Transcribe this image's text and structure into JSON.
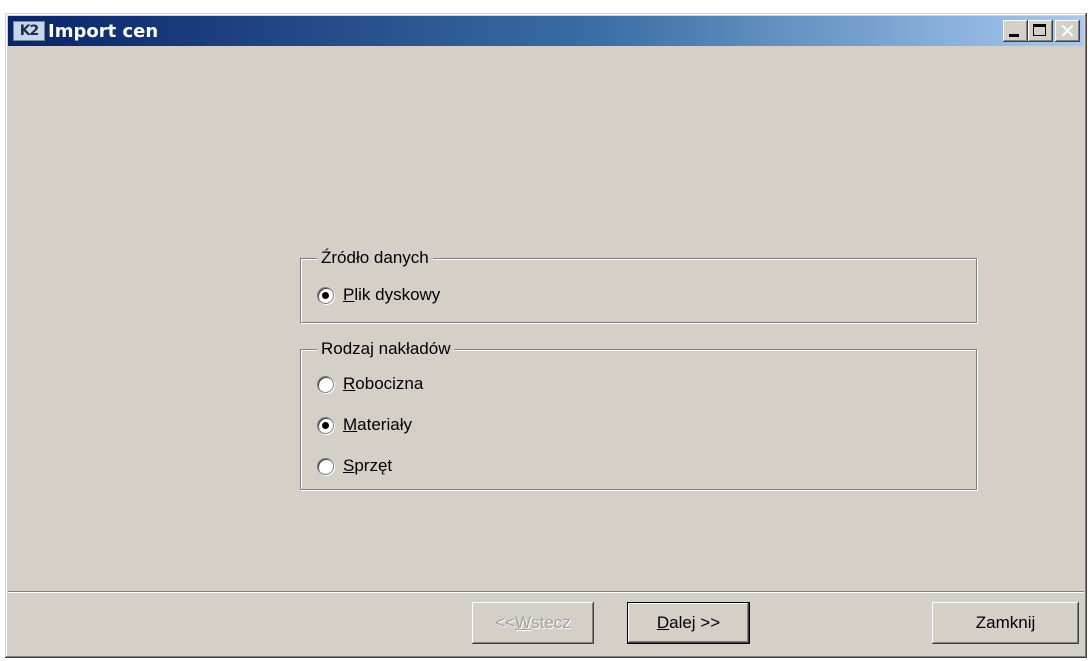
{
  "window": {
    "title": "Import cen",
    "icon_text": "K2",
    "caption_buttons": {
      "minimize": "minimize-icon",
      "maximize": "maximize-icon",
      "close": "✕"
    }
  },
  "source_group": {
    "legend": "Źródło danych",
    "options": [
      {
        "accel": "P",
        "rest": "lik dyskowy",
        "checked": true
      }
    ]
  },
  "type_group": {
    "legend": "Rodzaj nakładów",
    "options": [
      {
        "accel": "R",
        "rest": "obocizna",
        "checked": false
      },
      {
        "accel": "M",
        "rest": "ateriały",
        "checked": true
      },
      {
        "accel": "S",
        "rest": "przęt",
        "checked": false
      }
    ]
  },
  "buttons": {
    "back": {
      "prefix": "<< ",
      "accel": "W",
      "rest": "stecz",
      "enabled": false
    },
    "next": {
      "accel": "D",
      "rest": "alej >>",
      "enabled": true
    },
    "close": {
      "label": "Zamknij",
      "enabled": true
    }
  }
}
